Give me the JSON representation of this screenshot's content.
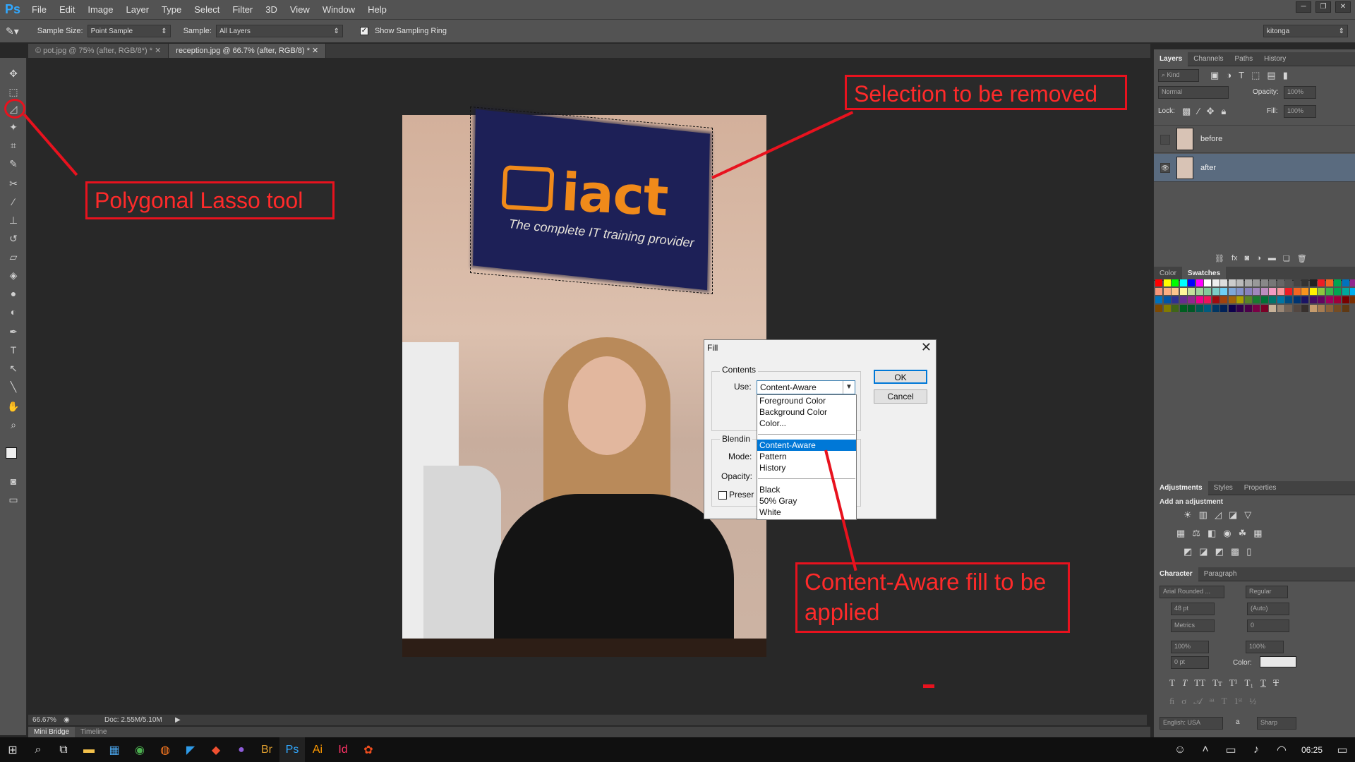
{
  "app": {
    "logo": "Ps"
  },
  "menu": [
    "File",
    "Edit",
    "Image",
    "Layer",
    "Type",
    "Select",
    "Filter",
    "3D",
    "View",
    "Window",
    "Help"
  ],
  "window_controls": [
    "─",
    "❐",
    "✕"
  ],
  "options": {
    "sample_size_label": "Sample Size:",
    "sample_size_value": "Point Sample",
    "sample_label": "Sample:",
    "sample_value": "All Layers",
    "show_ring_label": "Show Sampling Ring",
    "workspace_value": "kitonga"
  },
  "doc_tabs": [
    {
      "label": "© pot.jpg @ 75% (after, RGB/8*) *  ✕",
      "active": false
    },
    {
      "label": "reception.jpg @ 66.7% (after, RGB/8) *  ✕",
      "active": true
    }
  ],
  "photo": {
    "sign_text": "iact",
    "sign_tagline": "The complete IT training provider"
  },
  "fill_dialog": {
    "title": "Fill",
    "close": "✕",
    "contents_label": "Contents",
    "use_label": "Use:",
    "use_value": "Content-Aware",
    "blending_label": "Blendin",
    "mode_label": "Mode:",
    "opacity_label": "Opacity:",
    "preserve_label": "Preser",
    "ok": "OK",
    "cancel": "Cancel",
    "dropdown_groups": [
      [
        "Foreground Color",
        "Background Color",
        "Color..."
      ],
      [
        "Content-Aware",
        "Pattern",
        "History"
      ],
      [
        "Black",
        "50% Gray",
        "White"
      ]
    ],
    "selected_option": "Content-Aware"
  },
  "callouts": {
    "lasso": "Polygonal Lasso tool",
    "selection": "Selection to be removed",
    "content_aware": "Content-Aware fill to be applied"
  },
  "layers_panel": {
    "tabs": [
      "Layers",
      "Channels",
      "Paths",
      "History"
    ],
    "kind_label": "Kind",
    "blend_mode": "Normal",
    "opacity_label": "Opacity:",
    "opacity_value": "100%",
    "lock_label": "Lock:",
    "fill_label": "Fill:",
    "fill_value": "100%",
    "layers": [
      {
        "name": "before",
        "visible": false,
        "active": false
      },
      {
        "name": "after",
        "visible": true,
        "active": true
      }
    ]
  },
  "color_panel": {
    "tabs": [
      "Color",
      "Swatches"
    ]
  },
  "adjust_panel": {
    "tabs": [
      "Adjustments",
      "Styles",
      "Properties"
    ],
    "heading": "Add an adjustment"
  },
  "char_panel": {
    "tabs": [
      "Character",
      "Paragraph"
    ],
    "font_family": "Arial Rounded ...",
    "font_style": "Regular",
    "size": "48 pt",
    "leading": "(Auto)",
    "kerning": "Metrics",
    "tracking": "0",
    "vscale": "100%",
    "hscale": "100%",
    "baseline": "0 pt",
    "color_label": "Color:",
    "language": "English: USA",
    "aa_label": "a",
    "antialias": "Sharp"
  },
  "status": {
    "zoom": "66.67%",
    "doc": "Doc: 2.55M/5.10M"
  },
  "bottom_tabs": [
    "Mini Bridge",
    "Timeline"
  ],
  "taskbar": {
    "time": "06:25"
  },
  "swatch_colors": [
    "#ff0000",
    "#ffff00",
    "#00ff00",
    "#00ffff",
    "#0000ff",
    "#ff00ff",
    "#ffffff",
    "#eeeeee",
    "#dddddd",
    "#cccccc",
    "#bbbbbb",
    "#aaaaaa",
    "#999999",
    "#888888",
    "#777777",
    "#666666",
    "#555555",
    "#444444",
    "#333333",
    "#222222",
    "#ed1c24",
    "#f26522",
    "#00a651",
    "#0072bc",
    "#92278f",
    "#f7977a",
    "#fbad82",
    "#fdc68c",
    "#fff799",
    "#c4df9b",
    "#a3d39c",
    "#82ca9c",
    "#7bcdc8",
    "#6ecff6",
    "#7ea7d8",
    "#8493ca",
    "#8882be",
    "#a187be",
    "#bc8dbf",
    "#f49ac2",
    "#f6989d",
    "#ed1c24",
    "#f26522",
    "#f7941d",
    "#fff200",
    "#8dc63f",
    "#39b54a",
    "#00a651",
    "#00a99d",
    "#00aeef",
    "#0072bc",
    "#0054a6",
    "#2e3192",
    "#662d91",
    "#92278f",
    "#ec008c",
    "#ed145b",
    "#9e0b0f",
    "#a0410d",
    "#a36209",
    "#aba000",
    "#598527",
    "#197b30",
    "#007236",
    "#00746b",
    "#0076a3",
    "#004b80",
    "#003471",
    "#1b1464",
    "#440e62",
    "#630460",
    "#9e005d",
    "#9e0039",
    "#790000",
    "#7b2e00",
    "#7d4900",
    "#827b00",
    "#406618",
    "#005e20",
    "#005826",
    "#005952",
    "#005b7f",
    "#003663",
    "#002157",
    "#0d004c",
    "#32004b",
    "#4b0049",
    "#7b0046",
    "#7a0026",
    "#c7b299",
    "#998675",
    "#736357",
    "#534741",
    "#37302d",
    "#c69c6d",
    "#a67c52",
    "#8c6239",
    "#754c24",
    "#603913"
  ]
}
